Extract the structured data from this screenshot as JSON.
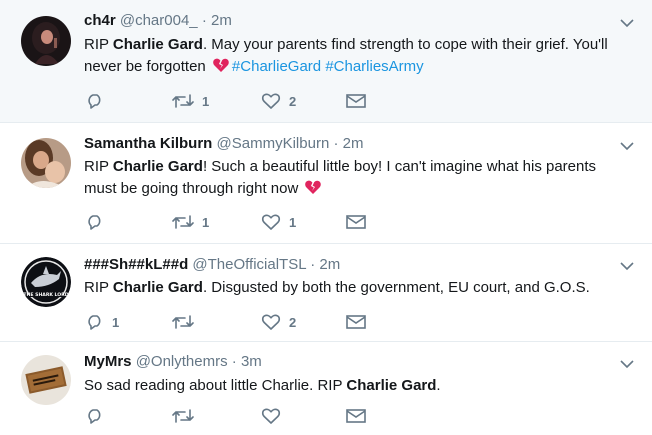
{
  "colors": {
    "text": "#14171a",
    "secondary": "#657786",
    "link": "#1b95e0",
    "highlight_bg": "#f5f8fa",
    "divider": "#e6ecf0",
    "broken_heart": "#e0245e"
  },
  "tweets": [
    {
      "name": "ch4r",
      "handle": "@char004_",
      "sep": "·",
      "time": "2m",
      "text": {
        "pre": "RIP ",
        "bold": "Charlie Gard",
        "post": ". May your parents find strength to cope with their grief. You'll never be forgotten ",
        "hashtags": [
          "#CharlieGard",
          "#CharliesArmy"
        ]
      },
      "emoji": "broken-heart",
      "replies": "",
      "retweets": "1",
      "likes": "2",
      "avatar_icon": "avatar-photo"
    },
    {
      "name": "Samantha Kilburn",
      "handle": "@SammyKilburn",
      "sep": "·",
      "time": "2m",
      "text": {
        "pre": "RIP ",
        "bold": "Charlie Gard",
        "post": "! Such a beautiful little boy! I can't imagine what his parents must be going through right now "
      },
      "emoji": "broken-heart",
      "replies": "",
      "retweets": "1",
      "likes": "1",
      "avatar_icon": "avatar-photo"
    },
    {
      "name": "###Sh##kL##d",
      "handle": "@TheOfficialTSL",
      "sep": "·",
      "time": "2m",
      "text": {
        "pre": "RIP ",
        "bold": "Charlie Gard",
        "post": ". Disgusted by both the government, EU court, and G.O.S."
      },
      "replies": "1",
      "retweets": "",
      "likes": "2",
      "avatar_icon": "shark-lord-logo",
      "avatar_text": "THE SHARK LORD"
    },
    {
      "name": "MyMrs",
      "handle": "@Onlythemrs",
      "sep": "·",
      "time": "3m",
      "text": {
        "pre": "So sad reading about little Charlie. RIP ",
        "bold": "Charlie Gard",
        "post": "."
      },
      "replies": "",
      "retweets": "",
      "likes": "",
      "avatar_icon": "doormat-photo"
    }
  ]
}
